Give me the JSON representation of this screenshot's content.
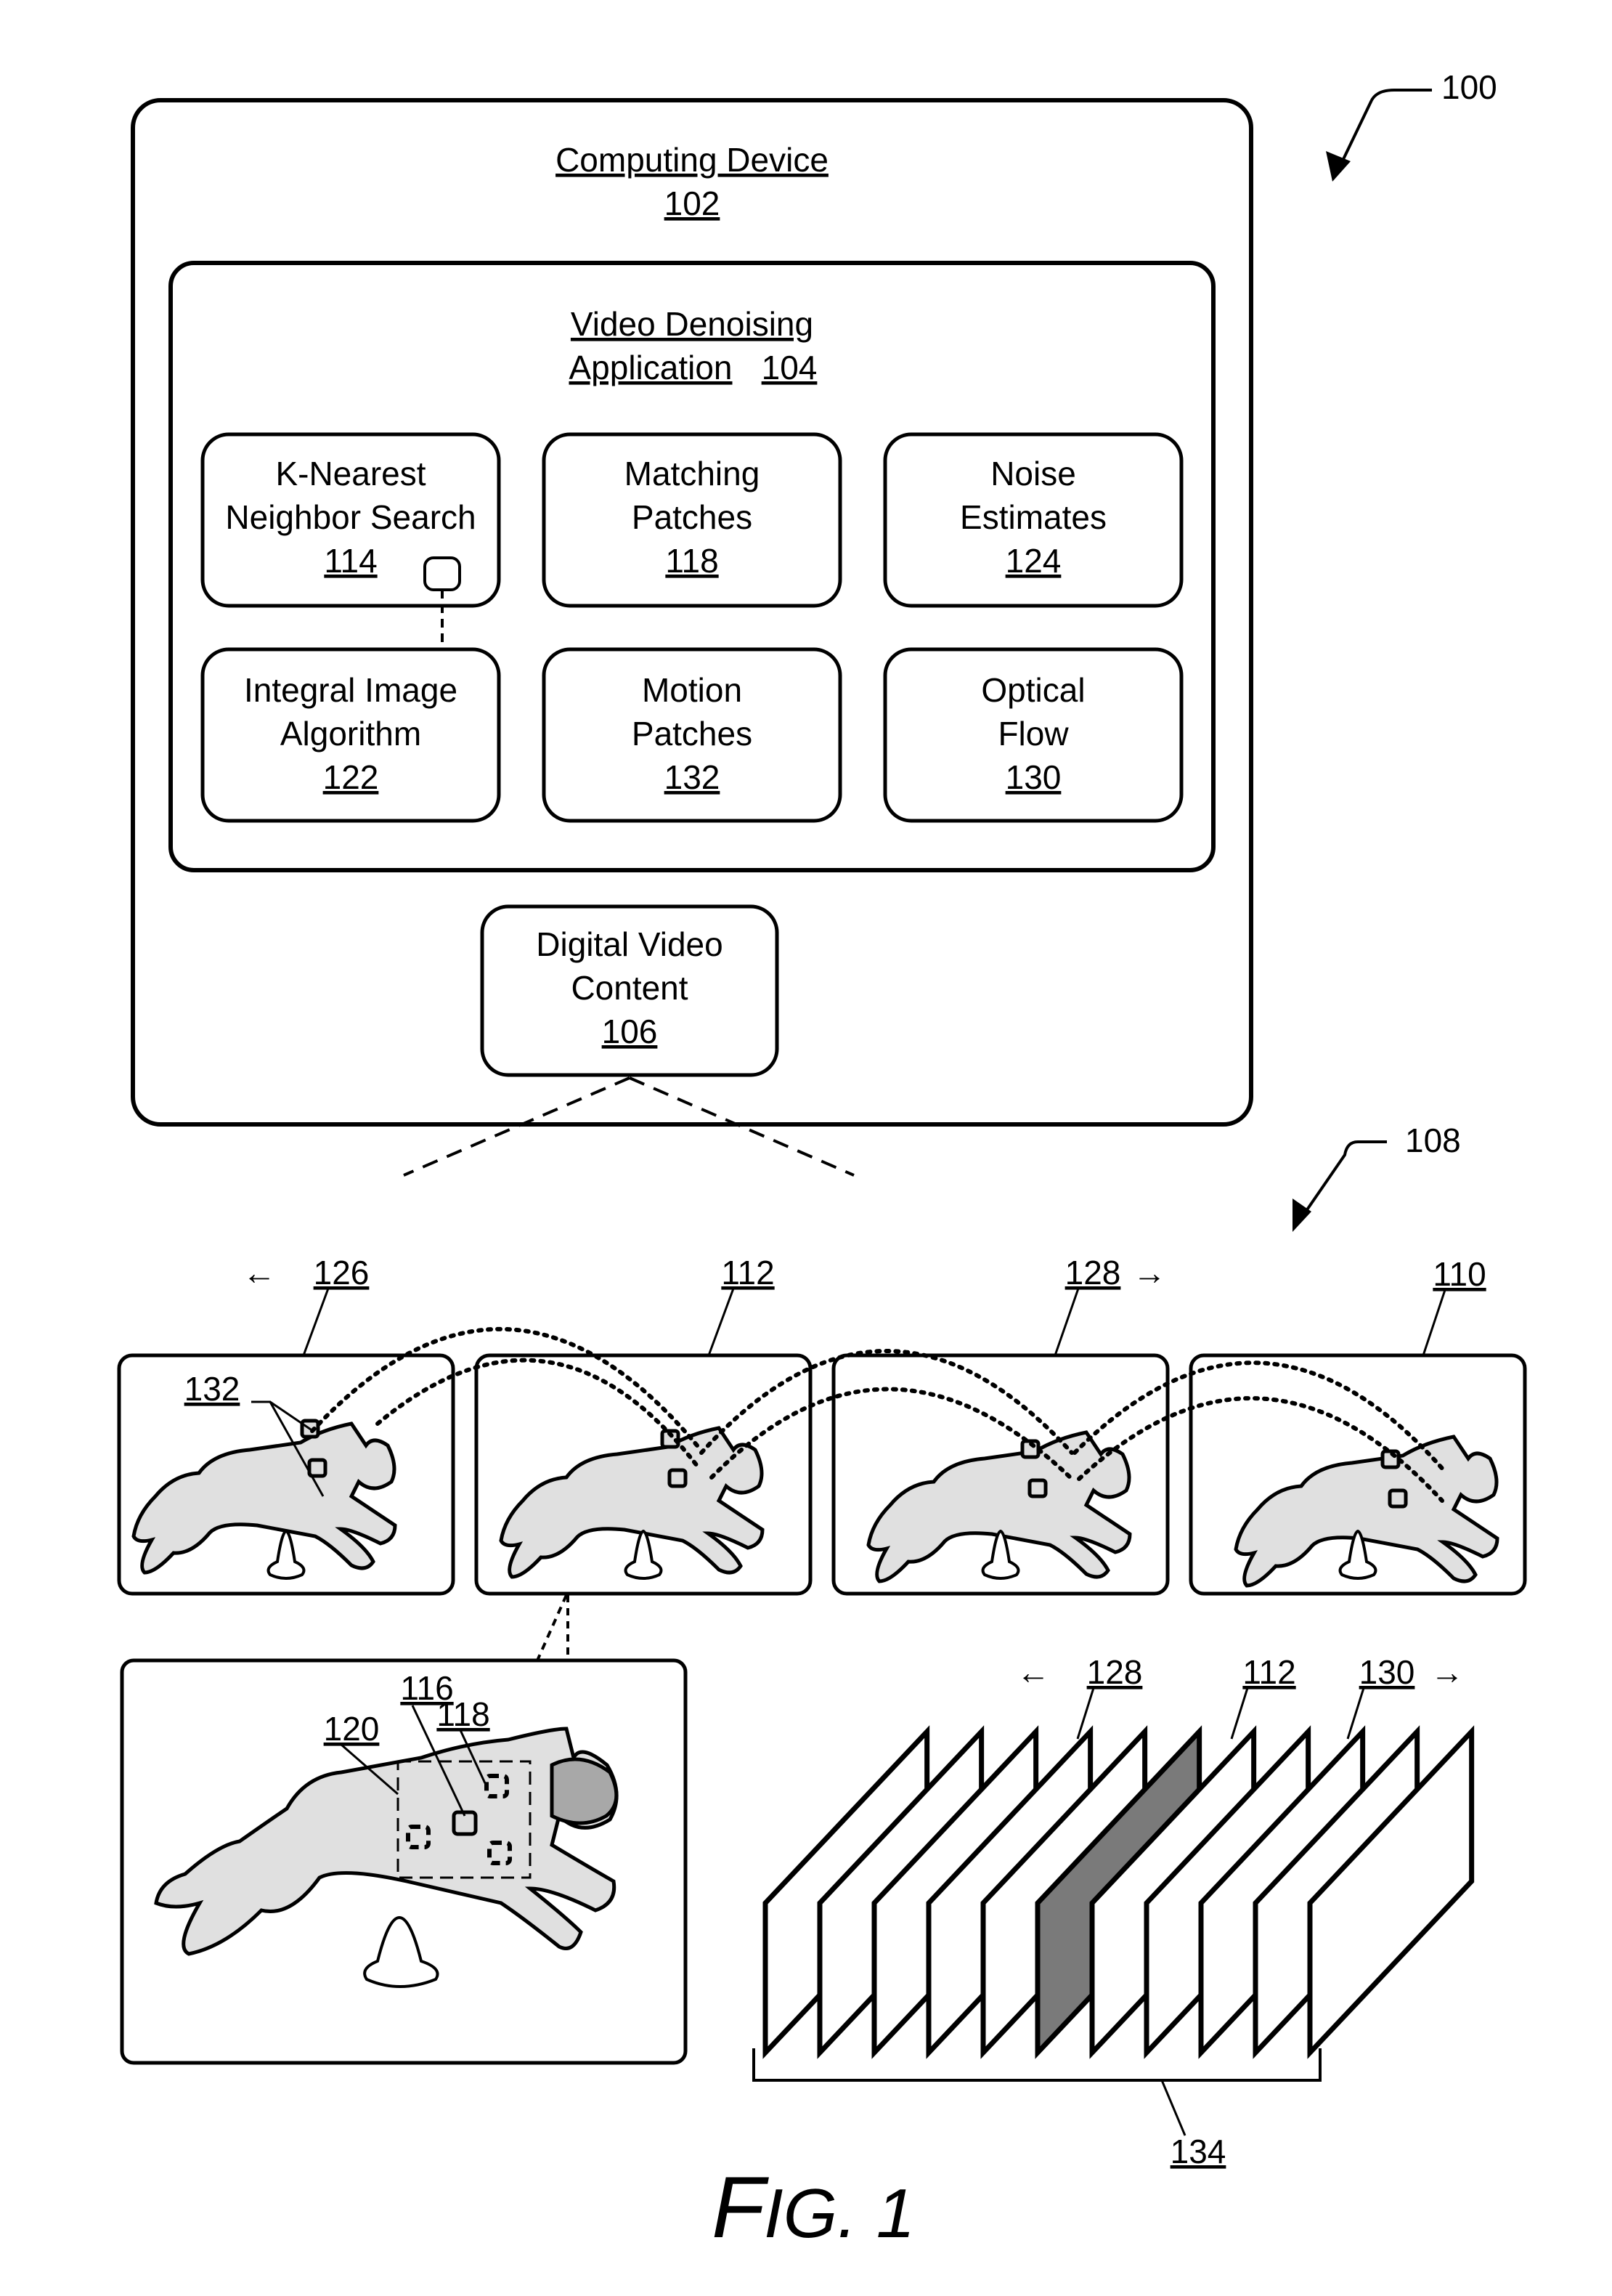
{
  "figure": {
    "label_first": "F",
    "label_rest": "IG. 1",
    "system_ref": "100",
    "frames_ref": "108"
  },
  "computing_device": {
    "title": "Computing Device",
    "ref": "102"
  },
  "application": {
    "title_line1": "Video Denoising",
    "title_line2": "Application",
    "ref": "104"
  },
  "modules": [
    {
      "line1": "K-Nearest",
      "line2": "Neighbor Search",
      "ref": "114"
    },
    {
      "line1": "Matching",
      "line2": "Patches",
      "ref": "118"
    },
    {
      "line1": "Noise",
      "line2": "Estimates",
      "ref": "124"
    },
    {
      "line1": "Integral Image",
      "line2": "Algorithm",
      "ref": "122"
    },
    {
      "line1": "Motion",
      "line2": "Patches",
      "ref": "132"
    },
    {
      "line1": "Optical",
      "line2": "Flow",
      "ref": "130"
    }
  ],
  "video_content": {
    "line1": "Digital Video",
    "line2": "Content",
    "ref": "106"
  },
  "frame_sequence": [
    {
      "ref": "126",
      "arrow": "←",
      "arrow_side": "left"
    },
    {
      "ref": "112",
      "arrow": "",
      "arrow_side": ""
    },
    {
      "ref": "128",
      "arrow": "→",
      "arrow_side": "right"
    },
    {
      "ref": "110",
      "arrow": "",
      "arrow_side": ""
    }
  ],
  "motion_patch_ref": "132",
  "detail_view": {
    "patch_ref": "116",
    "matching_ref": "118",
    "region_ref": "120"
  },
  "frame_stack": {
    "left_ref": "128",
    "left_arrow": "←",
    "center_ref": "112",
    "right_ref": "130",
    "right_arrow": "→",
    "group_ref": "134",
    "frame_count": 11,
    "highlighted_index": 5
  }
}
